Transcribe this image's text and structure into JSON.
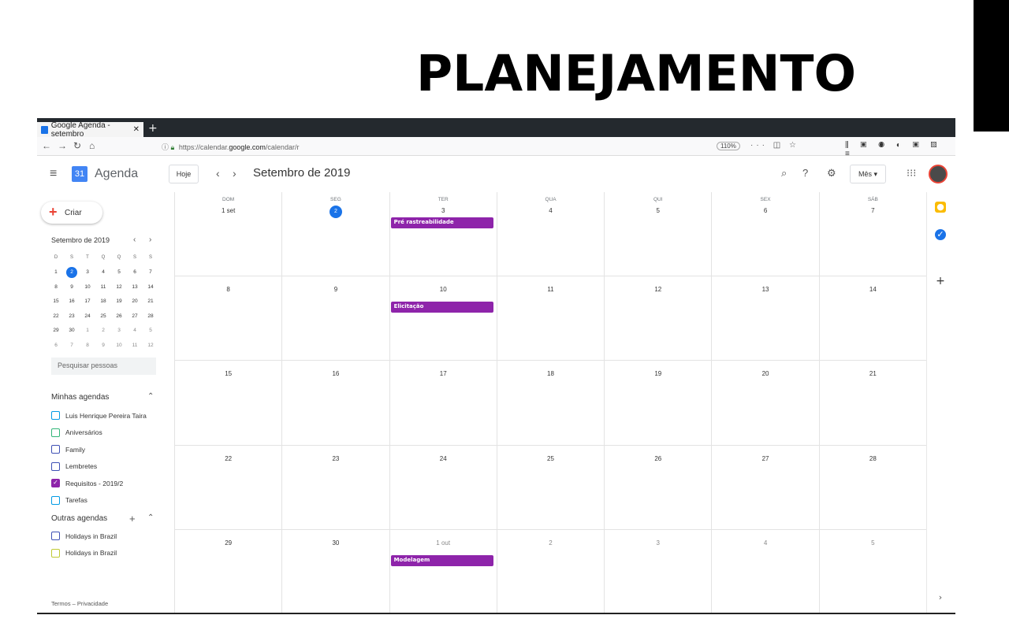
{
  "slide": {
    "title": "PLANEJAMENTO"
  },
  "browser": {
    "tab_title": "Google Agenda - setembro",
    "tab_close": "✕",
    "new_tab": "+",
    "url_prefix": "https://calendar.",
    "url_domain": "google.com",
    "url_path": "/calendar/r",
    "zoom": "110%"
  },
  "header": {
    "app_name": "Agenda",
    "logo_text": "31",
    "today_label": "Hoje",
    "month_title": "Setembro de 2019",
    "view_label": "Mês"
  },
  "sidebar": {
    "create_label": "Criar",
    "mini_title": "Setembro de 2019",
    "mini_head": [
      "D",
      "S",
      "T",
      "Q",
      "Q",
      "S",
      "S"
    ],
    "mini_weeks": [
      [
        "1",
        "2",
        "3",
        "4",
        "5",
        "6",
        "7"
      ],
      [
        "8",
        "9",
        "10",
        "11",
        "12",
        "13",
        "14"
      ],
      [
        "15",
        "16",
        "17",
        "18",
        "19",
        "20",
        "21"
      ],
      [
        "22",
        "23",
        "24",
        "25",
        "26",
        "27",
        "28"
      ],
      [
        "29",
        "30",
        "1",
        "2",
        "3",
        "4",
        "5"
      ],
      [
        "6",
        "7",
        "8",
        "9",
        "10",
        "11",
        "12"
      ]
    ],
    "search_placeholder": "Pesquisar pessoas",
    "my_calendars_title": "Minhas agendas",
    "my_calendars": [
      {
        "label": "Luis Henrique Pereira Taira",
        "color": "#039be5",
        "checked": false
      },
      {
        "label": "Aniversários",
        "color": "#33b679",
        "checked": false
      },
      {
        "label": "Family",
        "color": "#3f51b5",
        "checked": false
      },
      {
        "label": "Lembretes",
        "color": "#3f51b5",
        "checked": false
      },
      {
        "label": "Requisitos - 2019/2",
        "color": "#8e24aa",
        "checked": true
      },
      {
        "label": "Tarefas",
        "color": "#039be5",
        "checked": false
      }
    ],
    "other_calendars_title": "Outras agendas",
    "other_calendars": [
      {
        "label": "Holidays in Brazil",
        "color": "#3f51b5",
        "checked": false
      },
      {
        "label": "Holidays in Brazil",
        "color": "#c0ca33",
        "checked": false
      }
    ],
    "footer": "Termos – Privacidade"
  },
  "calendar": {
    "dow": [
      "DOM",
      "SEG",
      "TER",
      "QUA",
      "QUI",
      "SEX",
      "SÁB"
    ],
    "weeks": [
      [
        "1 set",
        "2",
        "3",
        "4",
        "5",
        "6",
        "7"
      ],
      [
        "8",
        "9",
        "10",
        "11",
        "12",
        "13",
        "14"
      ],
      [
        "15",
        "16",
        "17",
        "18",
        "19",
        "20",
        "21"
      ],
      [
        "22",
        "23",
        "24",
        "25",
        "26",
        "27",
        "28"
      ],
      [
        "29",
        "30",
        "1 out",
        "2",
        "3",
        "4",
        "5"
      ]
    ],
    "today_label": "2",
    "events": [
      {
        "week": 0,
        "day": 2,
        "title": "Pré rastreabilidade"
      },
      {
        "week": 1,
        "day": 2,
        "title": "Elicitação"
      },
      {
        "week": 4,
        "day": 2,
        "title": "Modelagem"
      }
    ]
  },
  "colors": {
    "accent": "#1a73e8",
    "event": "#8e24aa"
  }
}
